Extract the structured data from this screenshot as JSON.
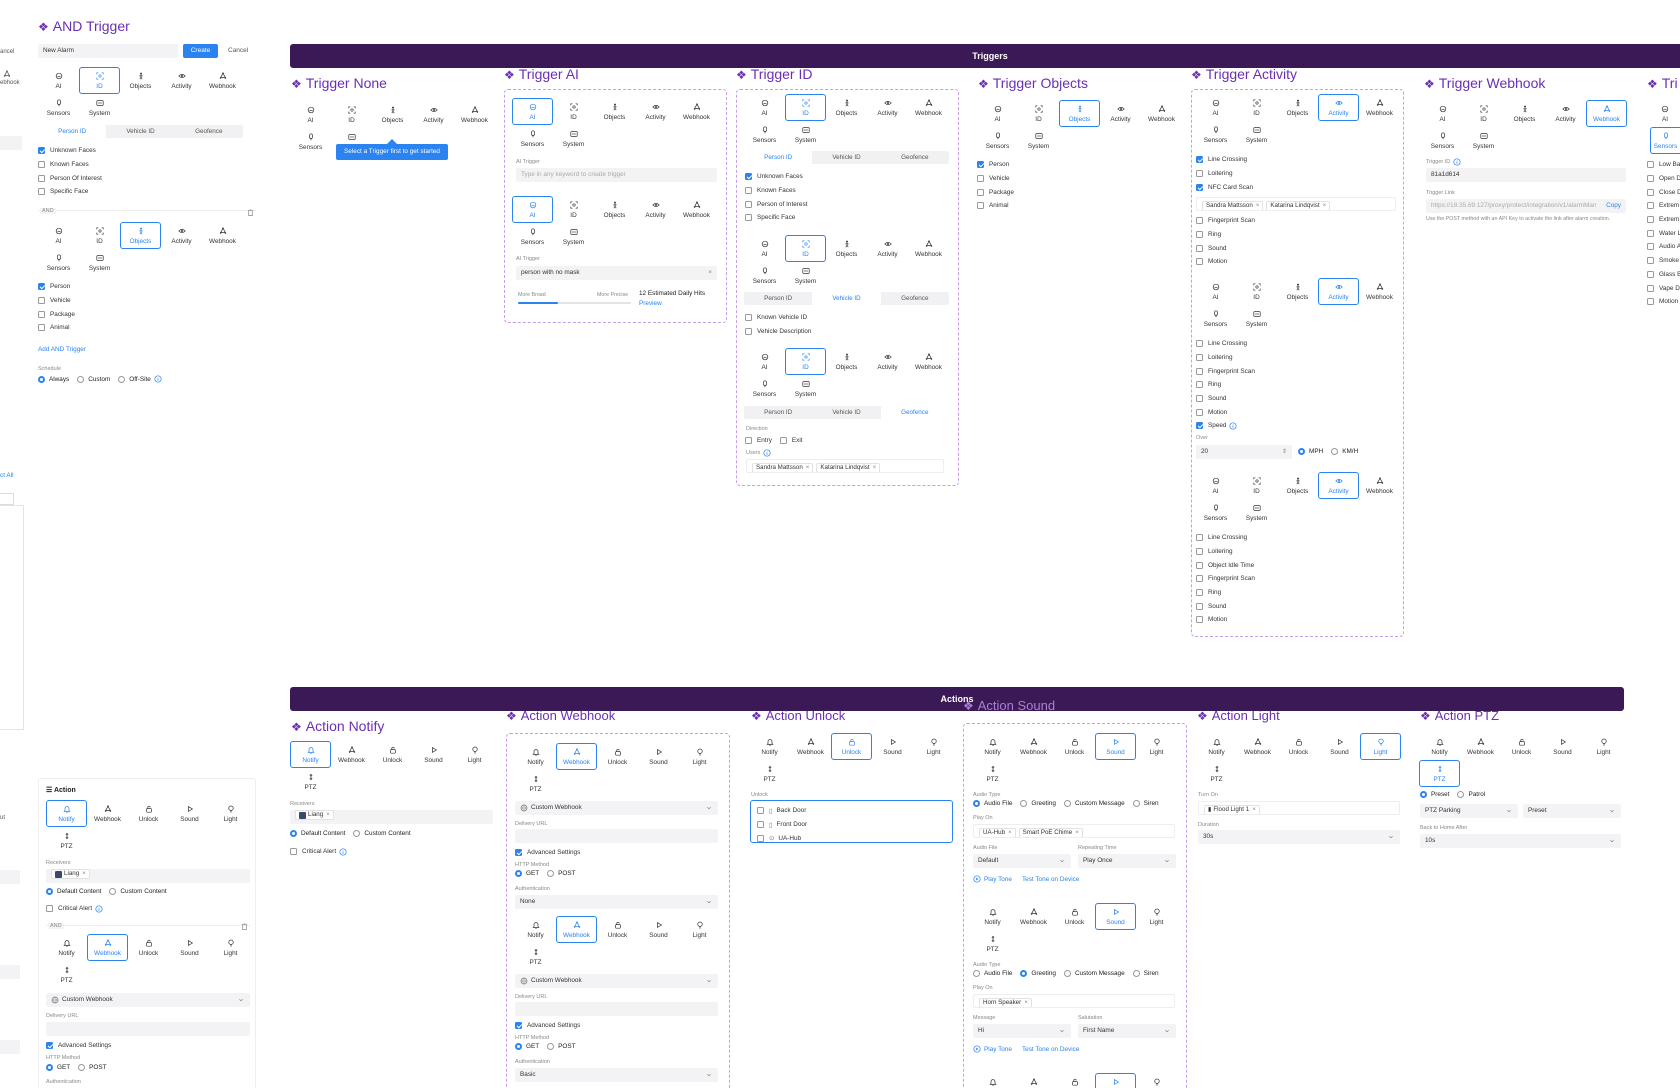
{
  "and_trigger": {
    "title": "AND Trigger",
    "alarm_name": "New Alarm",
    "create": "Create",
    "cancel": "Cancel",
    "left_cancel": "ancel",
    "left_webhook": "ebhook",
    "select_all": "ct All",
    "and_label": "AND",
    "add_and": "Add AND Trigger",
    "schedule_label": "Schedule",
    "schedule_opts": [
      "Always",
      "Custom",
      "Off-Site"
    ],
    "id_opts": [
      "Unknown Faces",
      "Known Faces",
      "Person Of Interest",
      "Specific Face"
    ],
    "obj_opts": [
      "Person",
      "Vehicle",
      "Package",
      "Animal"
    ]
  },
  "trigger_tabs": [
    "AI",
    "ID",
    "Objects",
    "Activity",
    "Webhook",
    "Sensors",
    "System"
  ],
  "action_tabs": [
    "Notify",
    "Webhook",
    "Unlock",
    "Sound",
    "Light",
    "PTZ"
  ],
  "id_subtabs": [
    "Person ID",
    "Vehicle ID",
    "Geofence"
  ],
  "banners": {
    "triggers": "Triggers",
    "actions": "Actions"
  },
  "trigger_none": {
    "title": "Trigger None",
    "tooltip": "Select a Trigger first to get started"
  },
  "trigger_ai": {
    "title": "Trigger AI",
    "label": "AI Trigger",
    "placeholder": "Type in any keyword to create trigger",
    "value": "person with no mask",
    "more_broad": "More Broad",
    "more_precise": "More Precise",
    "hits_count": "12",
    "hits": "Estimated Daily Hits",
    "preview": "Preview"
  },
  "trigger_id": {
    "title": "Trigger ID",
    "person_opts": [
      "Unknown Faces",
      "Known Faces",
      "Person of Interest",
      "Specific Face"
    ],
    "vehicle_opts": [
      "Known Vehicle ID",
      "Vehicle Description"
    ],
    "direction": "Direction",
    "entry": "Entry",
    "exit": "Exit",
    "users": "Users",
    "user_chips": [
      "Sandra Mattsson",
      "Katarina Lindqvist"
    ]
  },
  "trigger_objects": {
    "title": "Trigger Objects",
    "opts": [
      "Person",
      "Vehicle",
      "Package",
      "Animal"
    ]
  },
  "trigger_activity": {
    "title": "Trigger Activity",
    "list1": [
      "Line Crossing",
      "Loitering",
      "NFC Card Scan"
    ],
    "chips": [
      "Sandra Mattsson",
      "Katarina Lindqvist"
    ],
    "list1b": [
      "Fingerprint Scan",
      "Ring",
      "Sound",
      "Motion"
    ],
    "list2": [
      "Line Crossing",
      "Loitering",
      "Fingerprint Scan",
      "Ring",
      "Sound",
      "Motion",
      "Speed"
    ],
    "over": "Over",
    "over_val": "20",
    "mph": "MPH",
    "kmh": "KM/H",
    "list3": [
      "Line Crossing",
      "Loitering",
      "Object Idle Time",
      "Fingerprint Scan",
      "Ring",
      "Sound",
      "Motion"
    ]
  },
  "trigger_webhook": {
    "title": "Trigger Webhook",
    "id_label": "Trigger ID",
    "id_val": "81a1d614",
    "link_label": "Trigger Link",
    "link_val": "https://18.35.69.127/proxy/protect/integration/v1/alarmManager",
    "copy": "Copy",
    "note": "Use the POST method with an API Key to activate the link after alarm creation."
  },
  "trigger_partial": {
    "title": "Tri",
    "opts": [
      "Low Ba",
      "Open D",
      "Close D",
      "Extrem",
      "Extrem",
      "Water L",
      "Audio A",
      "Smoke",
      "Glass B",
      "Vape D",
      "Motion"
    ]
  },
  "left_action": {
    "title": "Action",
    "receivers": "Receivers",
    "receiver": "Liang",
    "default_content": "Default Content",
    "custom_content": "Custom Content",
    "critical_alert": "Critical Alert",
    "and_label": "AND",
    "custom_webhook": "Custom Webhook",
    "delivery_url": "Delivery URL",
    "advanced": "Advanced Settings",
    "http_method": "HTTP Method",
    "get": "GET",
    "post": "POST",
    "auth": "Authentication",
    "side_snip": "ut"
  },
  "action_notify": {
    "title": "Action Notify",
    "receivers": "Receivers",
    "receiver": "Liang",
    "default_content": "Default Content",
    "custom_content": "Custom Content",
    "critical": "Critical Alert"
  },
  "action_webhook": {
    "title": "Action Webhook",
    "custom": "Custom Webhook",
    "delivery": "Delivery URL",
    "advanced": "Advanced Settings",
    "http": "HTTP Method",
    "get": "GET",
    "post": "POST",
    "auth": "Authentication",
    "auth_val1": "None",
    "auth_val2": "Basic"
  },
  "action_unlock": {
    "title": "Action Unlock",
    "label": "Unlock",
    "doors": [
      "Back Door",
      "Front Door",
      "UA-Hub"
    ]
  },
  "action_sound": {
    "title": "Action Sound",
    "audio_type": "Audio Type",
    "types": [
      "Audio File",
      "Greeting",
      "Custom Message",
      "Siren"
    ],
    "play_on": "Play On",
    "chips1": [
      "UA-Hub",
      "Smart PoE Chime"
    ],
    "audio_file": "Audio File",
    "repeat": "Repeating Time",
    "default": "Default",
    "play_once": "Play Once",
    "play_tone": "Play Tone",
    "test_tone": "Test Tone on Device",
    "chips2": [
      "Horn Speaker"
    ],
    "message": "Message",
    "salutation": "Salutation",
    "msg_val": "Hi",
    "sal_val": "First Name"
  },
  "action_light": {
    "title": "Action Light",
    "turn_on": "Turn On",
    "light": "Flood Light 1",
    "duration": "Duration",
    "dur_val": "30s"
  },
  "action_ptz": {
    "title": "Action PTZ",
    "preset": "Preset",
    "patrol": "Patrol",
    "ptz_parking": "PTZ Parking",
    "preset_val": "Preset",
    "back_home": "Back to Home After",
    "back_val": "10s"
  },
  "colors": {
    "accent": "#2a83ef",
    "title": "#6b2fb3",
    "banner": "#3b1956",
    "dash": "#c89ce6"
  }
}
